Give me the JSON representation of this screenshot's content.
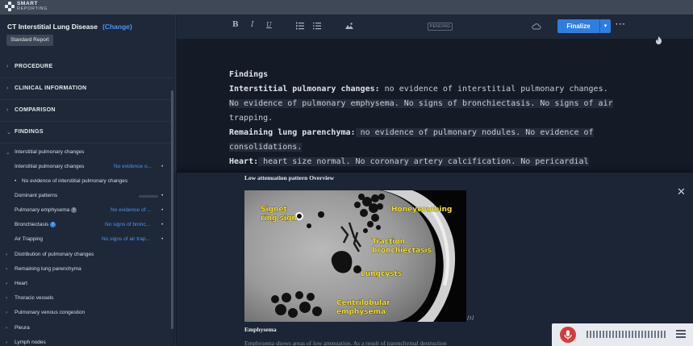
{
  "app": {
    "logo_top": "SMART",
    "logo_bottom": "REPORTING"
  },
  "sidebar": {
    "title": "CT Interstitial Lung Disease",
    "change_label": "(Change)",
    "template_button": "Standard Report",
    "sections": [
      {
        "label": "PROCEDURE"
      },
      {
        "label": "CLINICAL INFORMATION"
      },
      {
        "label": "COMPARISON"
      },
      {
        "label": "FINDINGS"
      }
    ],
    "findings_group": "Interstitial pulmonary changes",
    "items": [
      {
        "label": "Interstitial pulmonary changes",
        "value": "No evidence o..."
      },
      {
        "label": "No evidence of interstitial pulmonary changes"
      },
      {
        "label": "Dominant patterns"
      },
      {
        "label": "Pulmonary emphysema",
        "badge": "i",
        "value": "No evidence of ..."
      },
      {
        "label": "Bronchiectasis",
        "badge": "i",
        "value": "No signs of bronc..."
      },
      {
        "label": "Air Trapping",
        "value": "No signs of air trap..."
      }
    ],
    "subgroups": [
      "Distribution of pulmonary changes",
      "Remaining lung parenchyma",
      "Heart",
      "Thoracic vessels",
      "Pulmonary venous congestion",
      "Pleura",
      "Lymph nodes"
    ]
  },
  "toolbar": {
    "bold": "B",
    "italic": "I",
    "underline": "U",
    "status": "PENDING",
    "finalize_label": "Finalize",
    "dropdown": "▾",
    "more": "···"
  },
  "report": {
    "heading": "Findings",
    "l1_label": "Interstitial pulmonary changes:",
    "l1_text": " no evidence of interstitial pulmonary changes.",
    "l2": "No evidence of pulmonary emphysema. No signs of bronchiectasis. No signs of air",
    "l3": "trapping.",
    "l4_label": "Remaining lung parenchyma:",
    "l4_text": " no evidence of pulmonary nodules. No evidence of",
    "l5": "consolidations.",
    "l6_label": "Heart:",
    "l6_text": " heart size normal. No coronary artery calcification. No pericardial"
  },
  "reference_panel": {
    "title": "Low attenuation pattern Overview",
    "image_labels": {
      "signet": [
        "Signet",
        "ring sign"
      ],
      "honeycombing": "Honeycombing",
      "traction": [
        "Traction",
        "bronchiectasis"
      ],
      "lungcysts": "Lungcysts",
      "centrilobular": [
        "Centrilobular",
        "emphysema"
      ]
    },
    "citation": "[1]",
    "subheading": "Emphysema",
    "body_tail": "Emphysema shows areas of low attenuation. As a result of parenchymal destruction"
  },
  "colors": {
    "accent": "#2f7de1",
    "link": "#4b96f0",
    "annotation": "#f4e02a",
    "mic": "#d63b3b"
  }
}
